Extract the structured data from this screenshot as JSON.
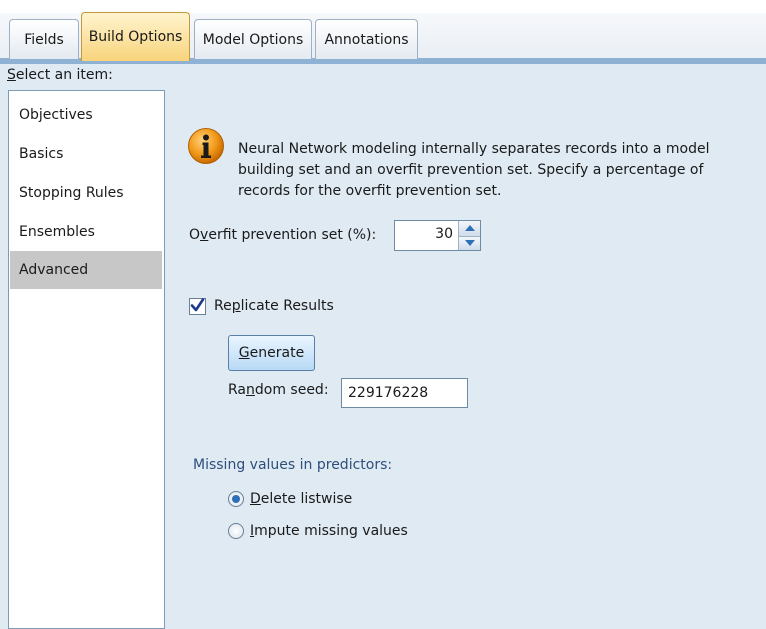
{
  "tabs": [
    {
      "label": "Fields"
    },
    {
      "label": "Build Options"
    },
    {
      "label": "Model Options"
    },
    {
      "label": "Annotations"
    }
  ],
  "sidebar": {
    "label_first": "S",
    "label_rest": "elect an item:",
    "items": [
      {
        "label": "Objectives"
      },
      {
        "label": "Basics"
      },
      {
        "label": "Stopping Rules"
      },
      {
        "label": "Ensembles"
      },
      {
        "label": "Advanced"
      }
    ],
    "selected": "Advanced"
  },
  "info": {
    "text": "Neural Network modeling internally separates records into a model building set and an overfit prevention set. Specify a percentage of records for the overfit prevention set."
  },
  "overfit": {
    "label_pre": "O",
    "label_u": "v",
    "label_post": "erfit prevention set (%):",
    "value": "30"
  },
  "replicate": {
    "label_pre": "Re",
    "label_u": "p",
    "label_post": "licate Results",
    "checked": true
  },
  "generate": {
    "label_u": "G",
    "label_post": "enerate"
  },
  "seed": {
    "label_pre": "Ra",
    "label_u": "n",
    "label_post": "dom seed:",
    "value": "229176228"
  },
  "missing": {
    "label": "Missing values in predictors:",
    "options": [
      {
        "u": "D",
        "rest": "elete listwise",
        "selected": true
      },
      {
        "u": "I",
        "rest": "mpute missing values",
        "selected": false
      }
    ]
  },
  "colors": {
    "accent": "#f8d47c",
    "selection": "#c7c7c7",
    "panel": "#dfeaf3"
  }
}
